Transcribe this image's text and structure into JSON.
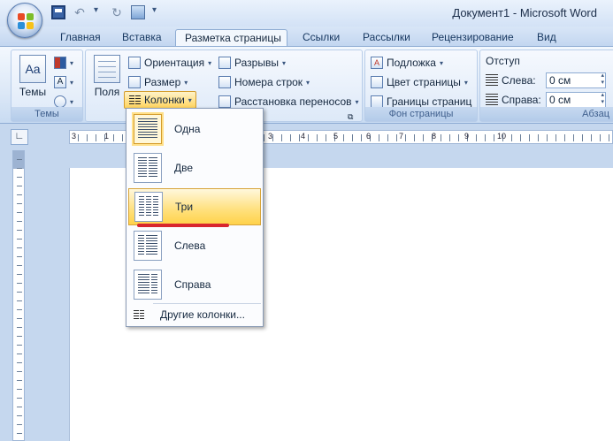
{
  "window": {
    "title": "Документ1 - Microsoft Word"
  },
  "tabs": [
    {
      "label": "Главная"
    },
    {
      "label": "Вставка"
    },
    {
      "label": "Разметка страницы"
    },
    {
      "label": "Ссылки"
    },
    {
      "label": "Рассылки"
    },
    {
      "label": "Рецензирование"
    },
    {
      "label": "Вид"
    }
  ],
  "ribbon": {
    "themes": {
      "button": "Темы",
      "group_label": "Темы"
    },
    "page_setup": {
      "margins": "Поля",
      "orientation": "Ориентация",
      "size": "Размер",
      "columns": "Колонки",
      "breaks": "Разрывы",
      "line_numbers": "Номера строк",
      "hyphenation": "Расстановка переносов"
    },
    "page_background": {
      "watermark": "Подложка",
      "page_color": "Цвет страницы",
      "page_borders": "Границы страниц",
      "group_label": "Фон страницы"
    },
    "paragraph": {
      "indent_label": "Отступ",
      "left_label": "Слева:",
      "left_value": "0 см",
      "right_label": "Справа:",
      "right_value": "0 см",
      "group_label": "Абзац"
    }
  },
  "ruler": {
    "numbers": [
      "3",
      "1",
      "2",
      "1",
      "1",
      "2",
      "3",
      "4",
      "5",
      "6",
      "7",
      "8",
      "9",
      "10"
    ]
  },
  "columns_menu": {
    "items": [
      {
        "label": "Одна",
        "cols": 1
      },
      {
        "label": "Две",
        "cols": 2
      },
      {
        "label": "Три",
        "cols": 3
      },
      {
        "label": "Слева",
        "cols": 2
      },
      {
        "label": "Справа",
        "cols": 2
      }
    ],
    "more": "Другие колонки..."
  }
}
